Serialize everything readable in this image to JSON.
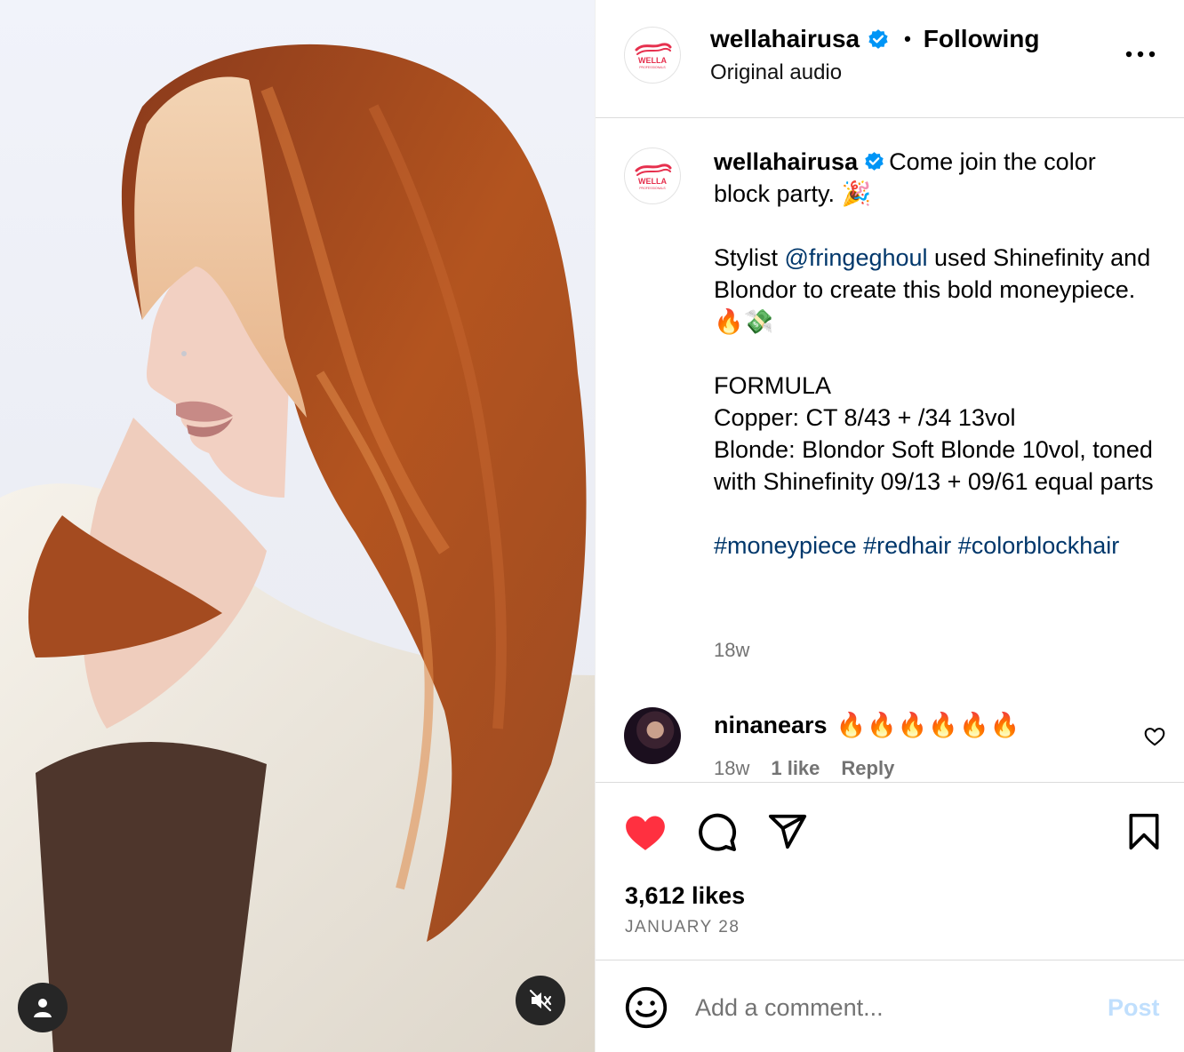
{
  "post": {
    "username": "wellahairusa",
    "follow_status": "Following",
    "audio": "Original audio",
    "brand_logo_text": "WELLA",
    "brand_logo_subtext": "PROFESSIONALS",
    "more_icon": "more-options-icon"
  },
  "caption": {
    "username": "wellahairusa",
    "intro": "Come join the color block party. 🎉",
    "stylist_prefix": "Stylist ",
    "stylist_mention": "@fringeghoul",
    "stylist_suffix": " used Shinefinity and Blondor to create this bold moneypiece. 🔥💸",
    "formula_title": "FORMULA",
    "formula_copper": "Copper: CT 8/43 + /34 13vol",
    "formula_blonde": "Blonde: Blondor Soft Blonde 10vol, toned with Shinefinity 09/13 + 09/61 equal parts",
    "hashtags": [
      "#moneypiece",
      "#redhair",
      "#colorblockhair"
    ],
    "time_ago": "18w"
  },
  "comment": {
    "username": "ninanears",
    "text": "🔥🔥🔥🔥🔥🔥",
    "time_ago": "18w",
    "likes": "1 like",
    "reply": "Reply"
  },
  "actions": {
    "liked": true,
    "likes_count": "3,612 likes",
    "date": "JANUARY 28",
    "like_color": "#ff3040"
  },
  "add_comment": {
    "placeholder": "Add a comment...",
    "post_label": "Post"
  },
  "colors": {
    "link": "#00376b",
    "secondary_text": "#737373",
    "verified": "#0095f6",
    "post_disabled": "#c0dffd"
  }
}
